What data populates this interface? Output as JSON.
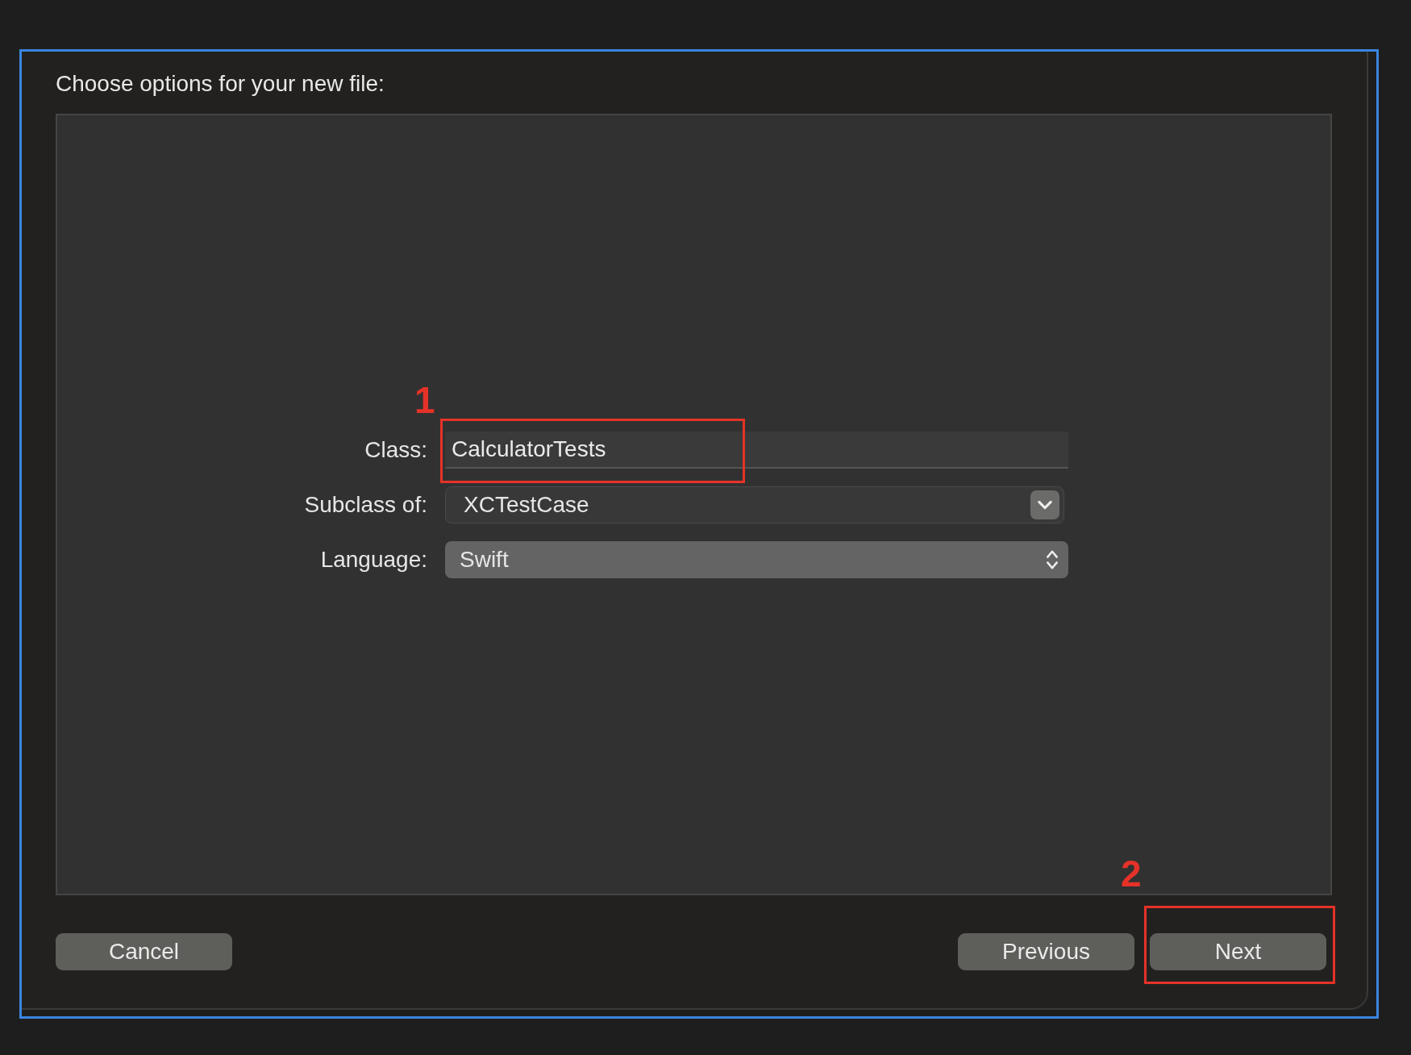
{
  "dialog": {
    "title": "Choose options for your new file:"
  },
  "fields": [
    {
      "label": "Class:",
      "kind": "text",
      "value": "CalculatorTests",
      "annotation": "1"
    },
    {
      "label": "Subclass of:",
      "kind": "combo",
      "value": "XCTestCase"
    },
    {
      "label": "Language:",
      "kind": "popup",
      "value": "Swift"
    }
  ],
  "left_buttons": [
    {
      "label": "Cancel"
    }
  ],
  "right_buttons": [
    {
      "label": "Previous"
    },
    {
      "label": "Next",
      "annotation": "2"
    }
  ]
}
